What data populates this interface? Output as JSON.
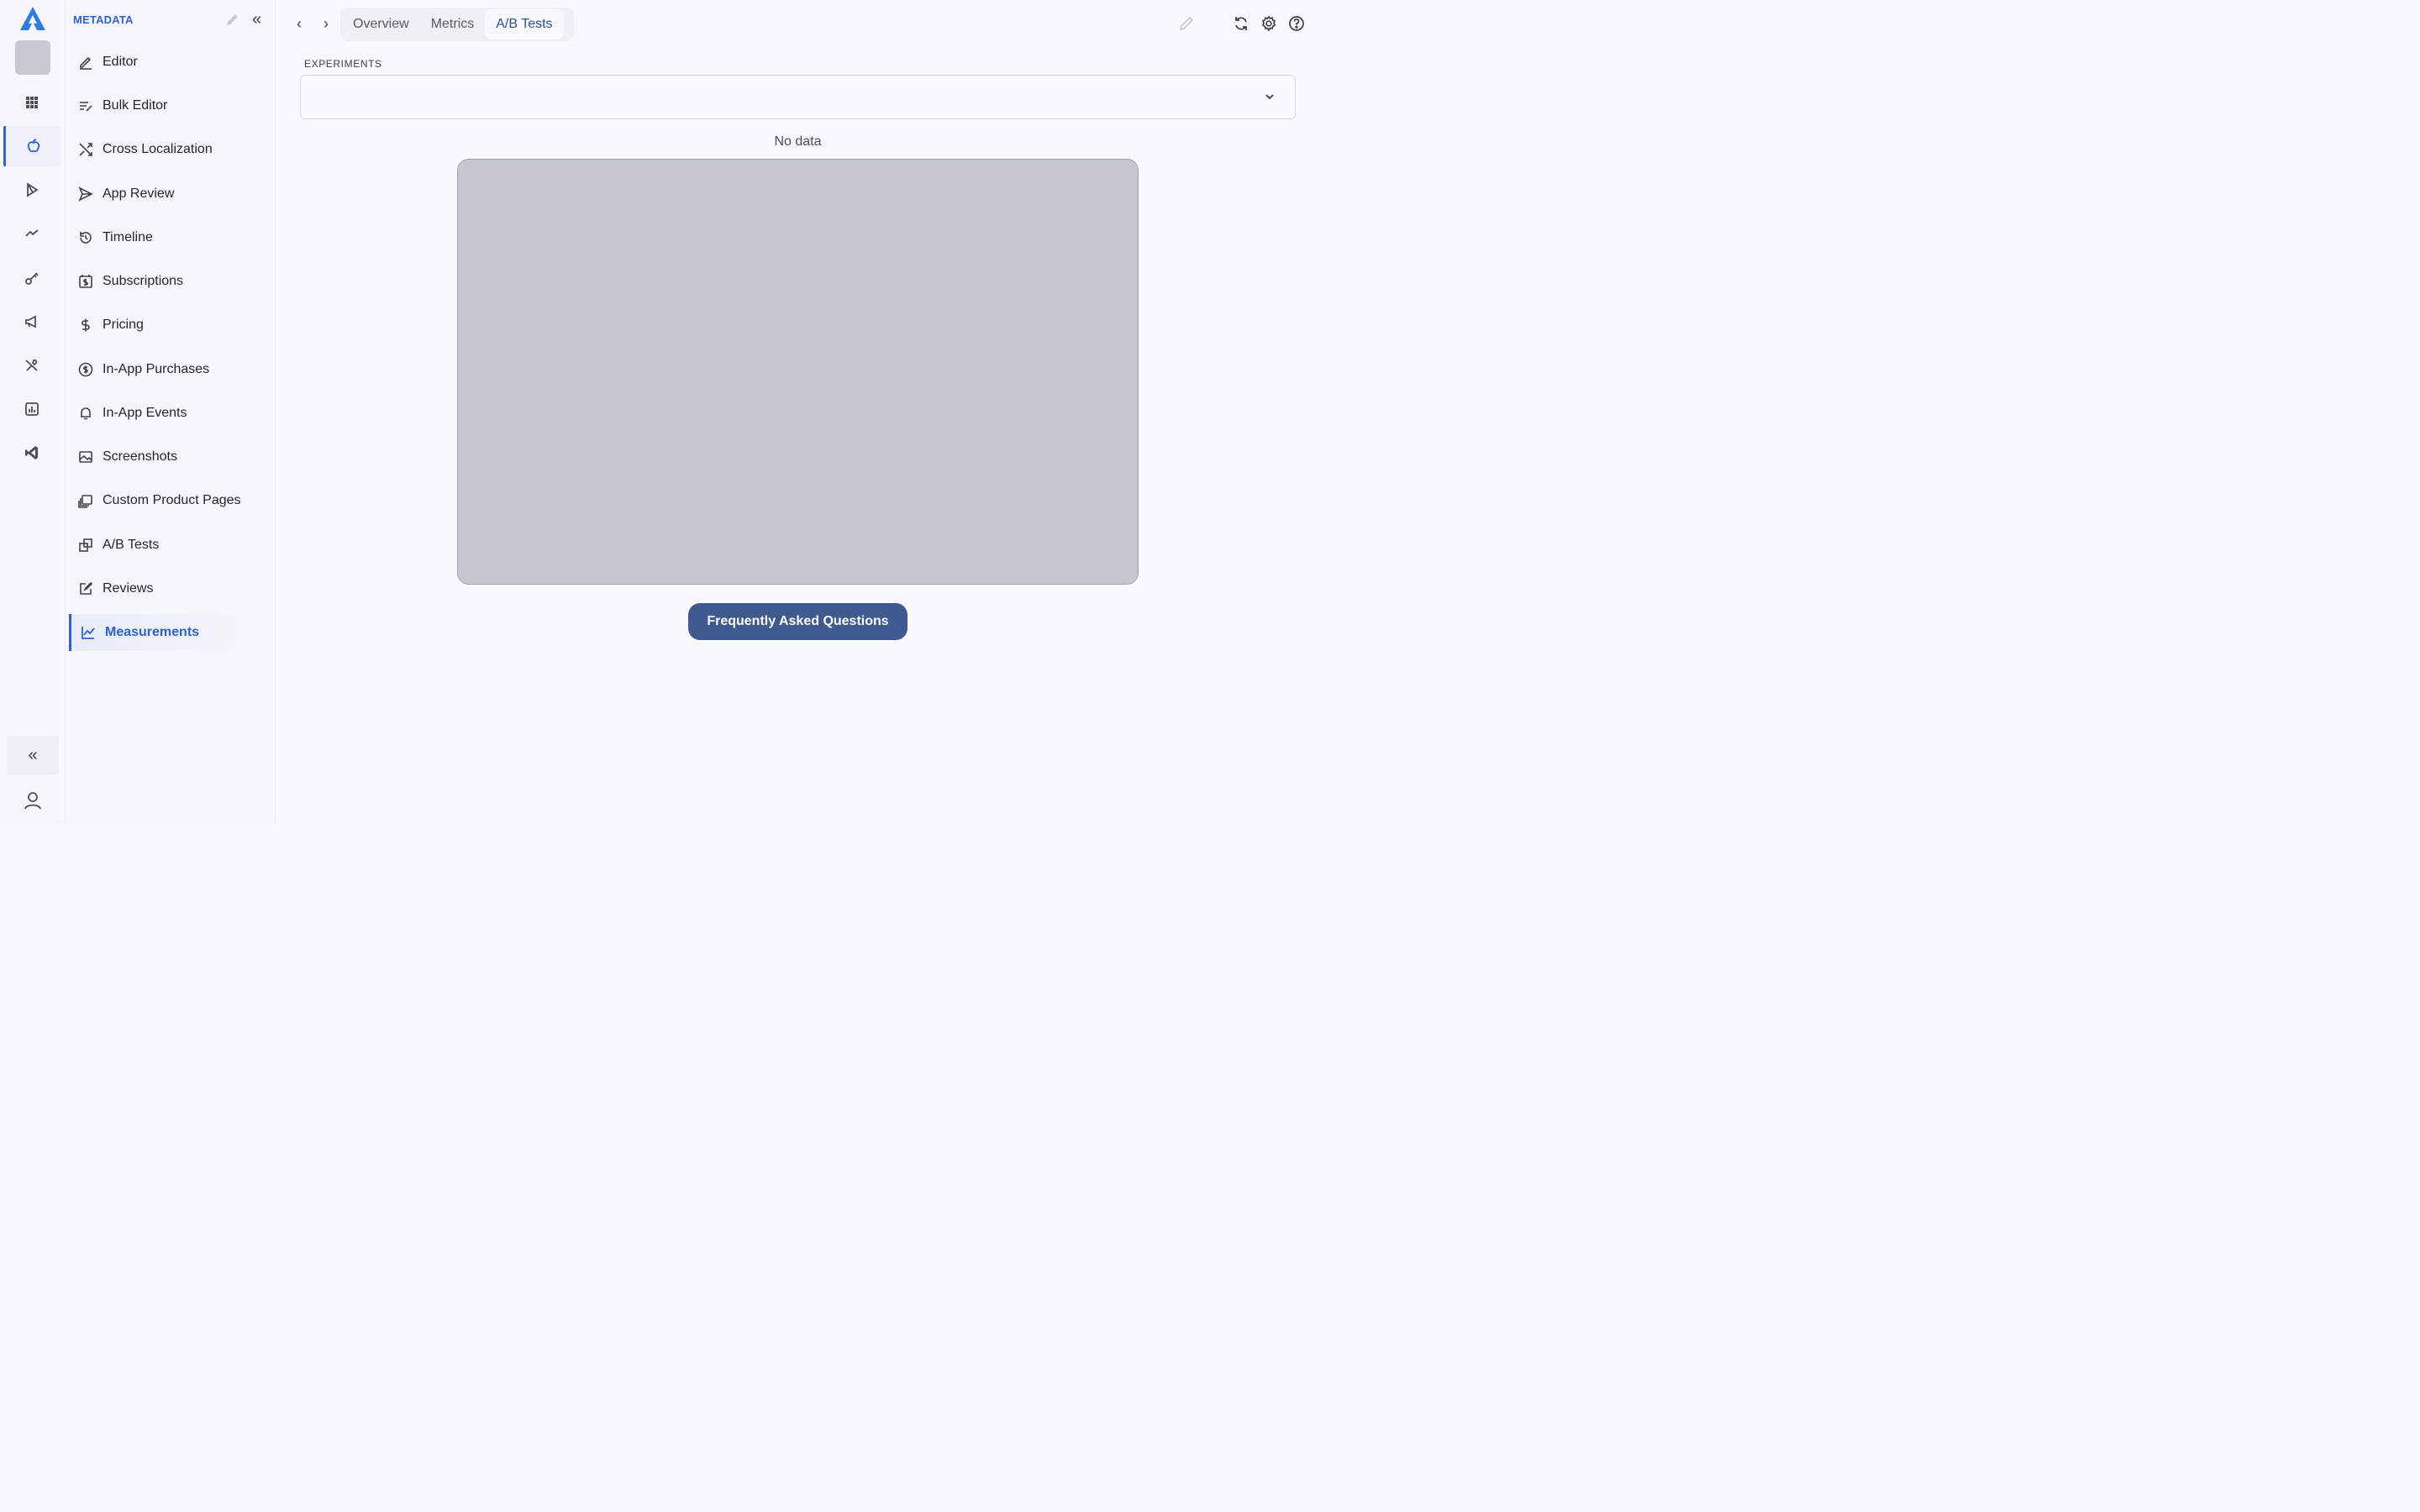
{
  "sidebar": {
    "title": "METADATA",
    "items": [
      {
        "label": "Editor",
        "icon": "pencil-line-icon"
      },
      {
        "label": "Bulk Editor",
        "icon": "list-edit-icon"
      },
      {
        "label": "Cross Localization",
        "icon": "shuffle-icon"
      },
      {
        "label": "App Review",
        "icon": "send-icon"
      },
      {
        "label": "Timeline",
        "icon": "history-icon"
      },
      {
        "label": "Subscriptions",
        "icon": "calendar-dollar-icon"
      },
      {
        "label": "Pricing",
        "icon": "dollar-icon"
      },
      {
        "label": "In-App Purchases",
        "icon": "coin-icon"
      },
      {
        "label": "In-App Events",
        "icon": "bell-icon"
      },
      {
        "label": "Screenshots",
        "icon": "image-icon"
      },
      {
        "label": "Custom Product Pages",
        "icon": "stacked-pages-icon"
      },
      {
        "label": "A/B Tests",
        "icon": "copy-squares-icon"
      },
      {
        "label": "Reviews",
        "icon": "review-edit-icon"
      },
      {
        "label": "Measurements",
        "icon": "line-chart-icon",
        "active": true
      }
    ]
  },
  "rail": {
    "icons": [
      "grid-icon",
      "apple-icon",
      "play-store-icon",
      "trend-icon",
      "key-icon",
      "megaphone-icon",
      "tools-icon",
      "bar-report-icon",
      "vscode-icon"
    ],
    "active": "apple-icon"
  },
  "tabs": [
    {
      "label": "Overview"
    },
    {
      "label": "Metrics"
    },
    {
      "label": "A/B Tests",
      "active": true
    }
  ],
  "experiments": {
    "label": "EXPERIMENTS",
    "value": ""
  },
  "empty_state": {
    "text": "No data"
  },
  "faq_button": {
    "label": "Frequently Asked Questions"
  },
  "colors": {
    "accent": "#2f63c9",
    "button": "#3e5a8e",
    "placeholder": "#c5c7ce",
    "background": "#f9f9fd"
  }
}
